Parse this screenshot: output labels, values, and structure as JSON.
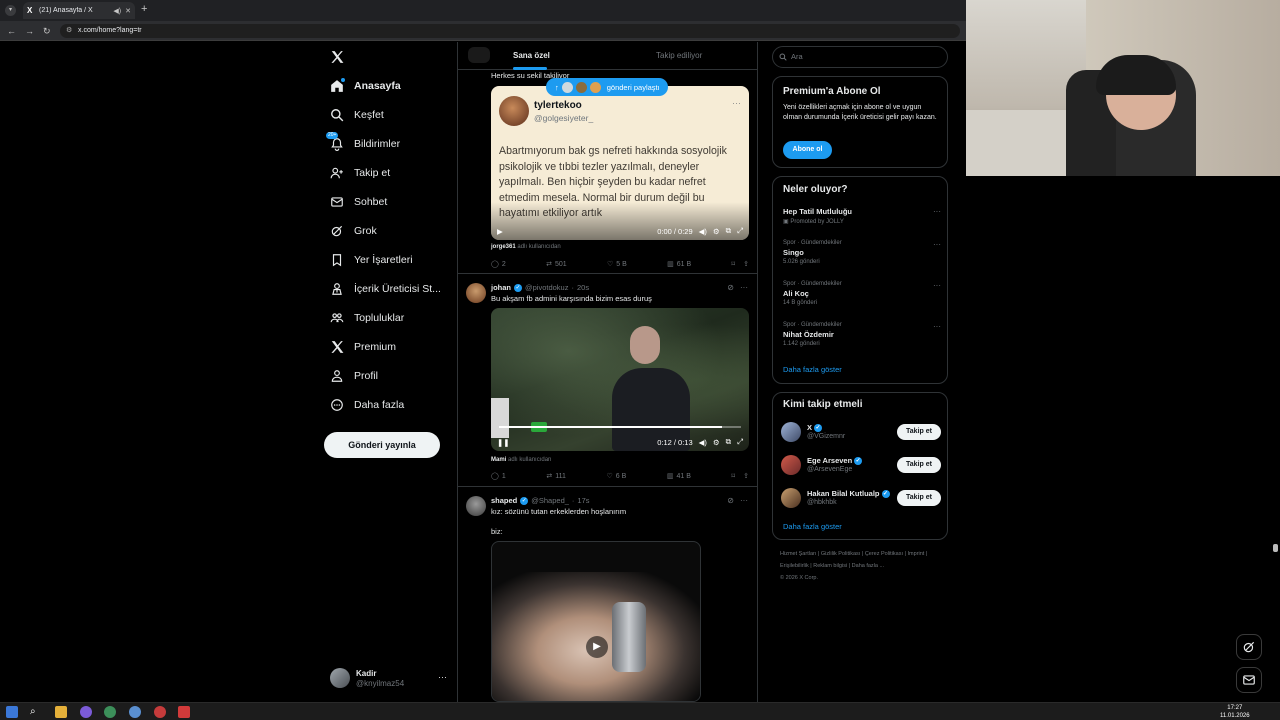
{
  "browser": {
    "tab_title": "(21) Anasayfa / X",
    "tab_favicon": "X",
    "url": "x.com/home?lang=tr"
  },
  "nav": {
    "items": [
      {
        "label": "Anasayfa",
        "icon": "home-icon",
        "active": true
      },
      {
        "label": "Keşfet",
        "icon": "search-icon"
      },
      {
        "label": "Bildirimler",
        "icon": "bell-icon",
        "badge": "20+"
      },
      {
        "label": "Takip et",
        "icon": "add-user-icon"
      },
      {
        "label": "Sohbet",
        "icon": "mail-icon"
      },
      {
        "label": "Grok",
        "icon": "grok-icon"
      },
      {
        "label": "Yer İşaretleri",
        "icon": "bookmark-icon"
      },
      {
        "label": "İçerik Üreticisi St...",
        "icon": "creator-icon"
      },
      {
        "label": "Topluluklar",
        "icon": "communities-icon"
      },
      {
        "label": "Premium",
        "icon": "x-logo-icon"
      },
      {
        "label": "Profil",
        "icon": "profile-icon"
      },
      {
        "label": "Daha fazla",
        "icon": "more-circle-icon"
      }
    ],
    "post_button": "Gönderi yayınla",
    "account": {
      "name": "Kadir",
      "handle": "@knyilmaz54"
    }
  },
  "feed": {
    "tabs": [
      "Sana özel",
      "Takip ediliyor"
    ],
    "new_posts_pill": "gönderi paylaştı",
    "post1": {
      "caption": "Herkes su sekil takiliyor",
      "quote_name": "tylertekoo",
      "quote_handle": "@golgesiyeter_",
      "quote_text": "Abartmıyorum bak gs nefreti hakkında sosyolojik psikolojik ve tıbbi tezler yazılmalı, deneyler yapılmalı. Ben hiçbir şeyden bu kadar nefret etmedim mesela. Normal bir durum değil bu hayatımı etkiliyor artık",
      "video_time": "0:00 / 0:29",
      "used_by_name": "jorge361",
      "used_by_suffix": "adlı kullanıcıdan",
      "replies": "2",
      "reposts": "501",
      "likes": "5 B",
      "views": "61 B"
    },
    "post2": {
      "name": "johan",
      "handle": "@pivotdokuz",
      "time": "20s",
      "text": "Bu akşam fb admini karşısında bizim esas duruş",
      "video_time": "0:12 / 0:13",
      "progress": 0.92,
      "used_by_name": "Mami",
      "used_by_suffix": "adlı kullanıcıdan",
      "replies": "1",
      "reposts": "111",
      "likes": "6 B",
      "views": "41 B"
    },
    "post3": {
      "name": "shaped",
      "handle": "@Shaped_",
      "time": "17s",
      "text": "kız: sözünü tutan erkeklerden hoşlanırım",
      "text2": "biz:"
    }
  },
  "sidebar": {
    "search_placeholder": "Ara",
    "premium": {
      "title": "Premium'a Abone Ol",
      "desc": "Yeni özellikleri açmak için abone ol ve uygun olman durumunda İçerik üreticisi gelir payı kazan.",
      "button": "Abone ol"
    },
    "trends": {
      "title": "Neler oluyor?",
      "items": [
        {
          "category": "",
          "name": "Hep Tatil Mutluluğu",
          "count": "Promoted by JOLLY"
        },
        {
          "category": "Spor · Gündemdekiler",
          "name": "Singo",
          "count": "5.026 gönderi"
        },
        {
          "category": "Spor · Gündemdekiler",
          "name": "Ali Koç",
          "count": "14 B gönderi"
        },
        {
          "category": "Spor · Gündemdekiler",
          "name": "Nihat Özdemir",
          "count": "1.142 gönderi"
        }
      ],
      "show_more": "Daha fazla göster"
    },
    "who_to_follow": {
      "title": "Kimi takip etmeli",
      "items": [
        {
          "name": "X",
          "handle": "@VGizemnr",
          "button": "Takip et"
        },
        {
          "name": "Ege Arseven",
          "handle": "@ArsevenEge",
          "button": "Takip et"
        },
        {
          "name": "Hakan Bilal Kutlualp",
          "handle": "@hbkhbk",
          "button": "Takip et"
        }
      ],
      "show_more": "Daha fazla göster"
    },
    "footer": [
      "Hizmet Şartları",
      "Gizlilik Politikası",
      "Çerez Politikası",
      "Imprint",
      "Erişilebilirlik",
      "Reklam bilgisi",
      "Daha fazla ...",
      "© 2026 X Corp."
    ]
  },
  "taskbar": {
    "time": "17:27",
    "date": "11.01.2026"
  },
  "colors": {
    "accent": "#1d9bf0",
    "background": "#000000",
    "border": "#2f3336",
    "muted": "#71767b"
  }
}
